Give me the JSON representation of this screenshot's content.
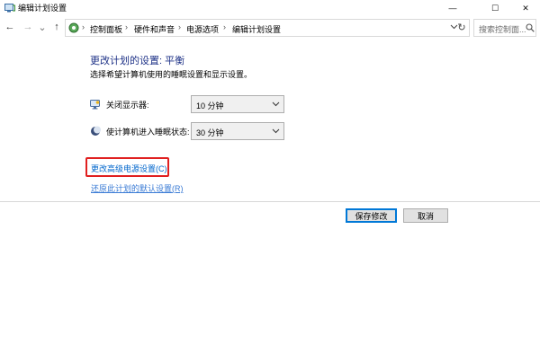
{
  "window": {
    "title": "编辑计划设置",
    "minimize_glyph": "—",
    "maximize_glyph": "☐",
    "close_glyph": "✕"
  },
  "nav": {
    "back_glyph": "←",
    "forward_glyph": "→",
    "history_glyph": "⌄",
    "up_glyph": "↑",
    "separator": "›",
    "breadcrumbs": [
      "控制面板",
      "硬件和声音",
      "电源选项",
      "编辑计划设置"
    ],
    "refresh_glyph": "↻",
    "search_placeholder": "搜索控制面..."
  },
  "main": {
    "title": "更改计划的设置: 平衡",
    "description": "选择希望计算机使用的睡眠设置和显示设置。",
    "settings": [
      {
        "label": "关闭显示器:",
        "value": "10 分钟",
        "icon": "monitor-icon"
      },
      {
        "label": "使计算机进入睡眠状态:",
        "value": "30 分钟",
        "icon": "sleep-moon-icon"
      }
    ],
    "advanced_link": "更改高级电源设置(C)",
    "restore_link": "还原此计划的默认设置(R)"
  },
  "footer": {
    "save_label": "保存修改",
    "cancel_label": "取消"
  },
  "colors": {
    "title_blue": "#1e3287",
    "link_blue": "#0066cc",
    "highlight_red": "#e02020",
    "button_focus": "#0078d7"
  }
}
